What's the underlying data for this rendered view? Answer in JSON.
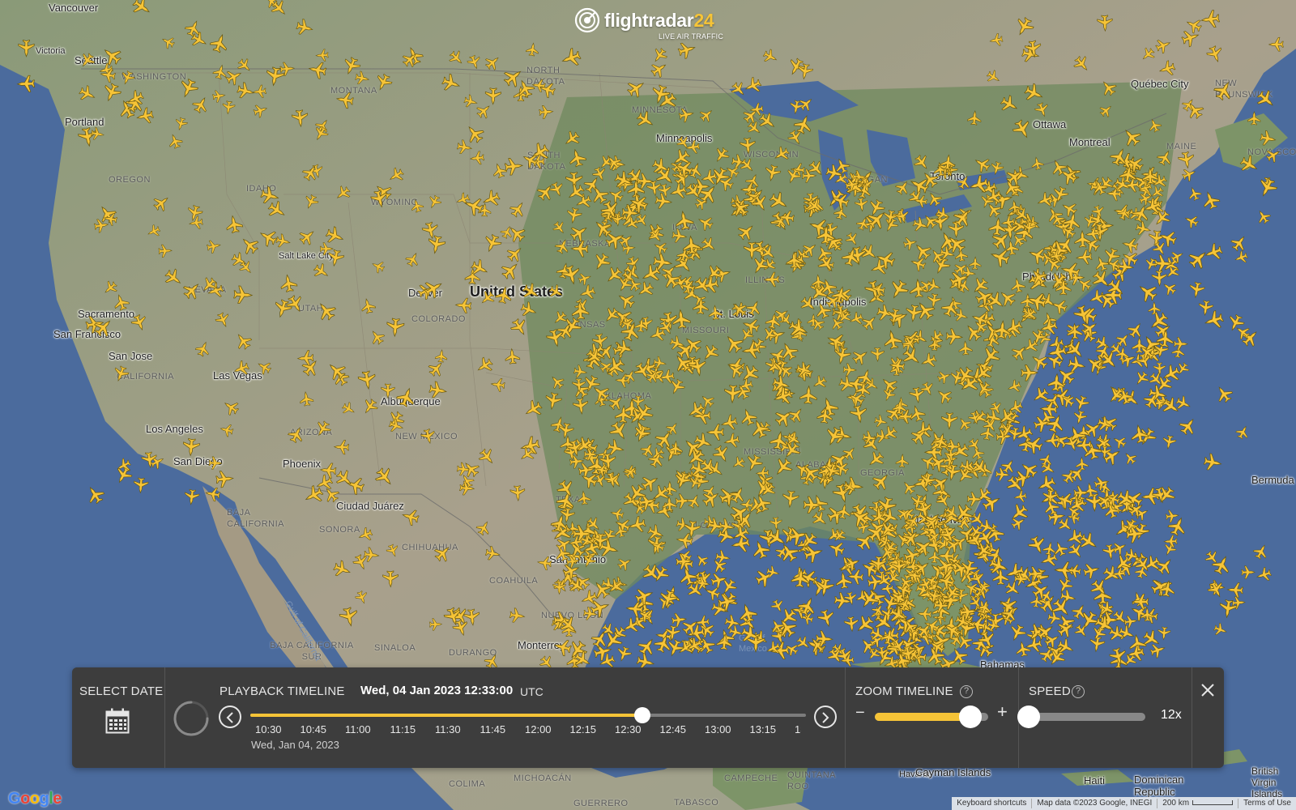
{
  "app": {
    "logo_word": "flightradar",
    "logo_num": "24",
    "logo_tagline": "LIVE AIR TRAFFIC"
  },
  "map": {
    "cities": [
      "Vancouver",
      "Victoria",
      "Seattle",
      "Portland",
      "Sacramento",
      "San Francisco",
      "San Jose",
      "Las Vegas",
      "Los Angeles",
      "San Diego",
      "Phoenix",
      "Salt Lake City",
      "Denver",
      "Albuquerque",
      "Ciudad Juárez",
      "San Antonio",
      "Monterrey",
      "Minneapolis",
      "Toronto",
      "Ottawa",
      "Montreal",
      "Québec City",
      "St. Louis",
      "Indianapolis",
      "Philadelphia",
      "Jacksonville",
      "Bahamas",
      "Havana",
      "Cayman Islands",
      "Haiti",
      "Dominican Republic",
      "British Virgin Islands",
      "Bermuda"
    ],
    "country_label": "United States",
    "regions": [
      "WASHINGTON",
      "OREGON",
      "IDAHO",
      "MONTANA",
      "WYOMING",
      "NORTH DAKOTA",
      "SOUTH DAKOTA",
      "NEBRASKA",
      "MINNESOTA",
      "IOWA",
      "WISCONSIN",
      "MICHIGAN",
      "NEVADA",
      "UTAH",
      "COLORADO",
      "KANSAS",
      "MISSOURI",
      "ILLINOIS",
      "CALIFORNIA",
      "ARIZONA",
      "NEW MEXICO",
      "TEXAS",
      "OKLAHOMA",
      "LOUISIANA",
      "MISSISSIPPI",
      "ALABAMA",
      "GEORGIA",
      "NEW BRUNSWICK",
      "MAINE",
      "NOVA SCOTIA",
      "BAJA CALIFORNIA",
      "SONORA",
      "CHIHUAHUA",
      "COAHUILA",
      "NUEVO LEÓN",
      "SINALOA",
      "DURANGO",
      "BAJA CALIFORNIA SUR",
      "MICHOACÁN",
      "COLIMA",
      "GUERRERO",
      "TABASCO",
      "CAMPECHE",
      "QUINTANA ROO"
    ],
    "seas": [
      "Gulf of California",
      "Gulf of Mexico"
    ]
  },
  "playback": {
    "select_date_label": "SELECT DATE",
    "timeline_label": "PLAYBACK TIMELINE",
    "current_datetime": "Wed, 04 Jan 2023 12:33:00",
    "timezone": "UTC",
    "timeline_progress": 0.705,
    "ticks": [
      "10:30",
      "10:45",
      "11:00",
      "11:15",
      "11:30",
      "11:45",
      "12:00",
      "12:15",
      "12:30",
      "12:45",
      "13:00",
      "13:15",
      "13:30"
    ],
    "timeline_date": "Wed, Jan 04, 2023",
    "zoom_label": "ZOOM TIMELINE",
    "zoom_level": 0.84,
    "zoom_minus": "−",
    "zoom_plus": "+",
    "speed_label": "SPEED",
    "speed_level": 0.0,
    "speed_value": "12x",
    "help_glyph": "?",
    "accent_color": "#f6c437"
  },
  "footer": {
    "google": "Google",
    "keyboard_shortcuts": "Keyboard shortcuts",
    "map_data": "Map data ©2023 Google, INEGI",
    "scale": "200 km",
    "terms": "Terms of Use"
  },
  "icons": [
    "flightradar-logo-icon",
    "calendar-icon",
    "loading-spinner-icon",
    "chevron-left-icon",
    "chevron-right-icon",
    "help-icon",
    "close-icon",
    "airplane-icon"
  ]
}
